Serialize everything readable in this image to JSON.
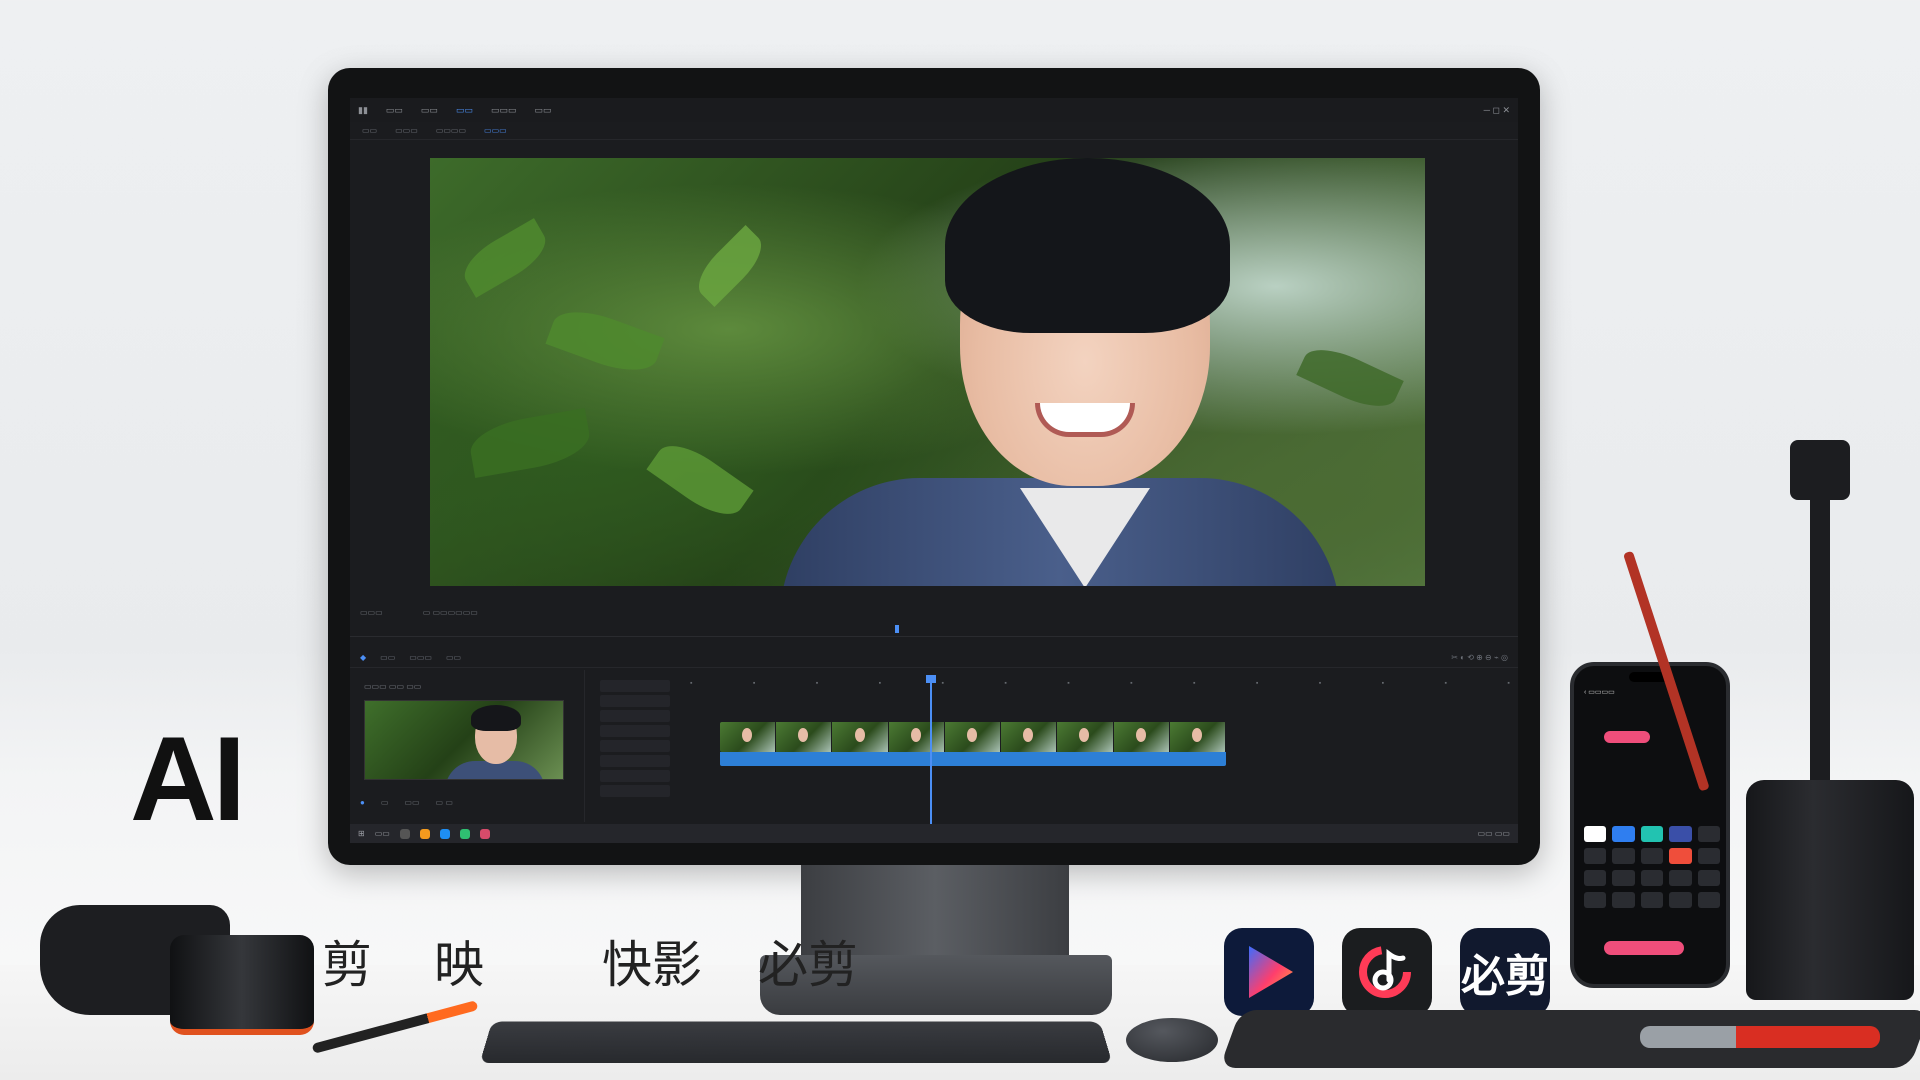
{
  "headline": {
    "title": "AI"
  },
  "apps": [
    {
      "name": "剪映"
    },
    {
      "name": "快影"
    },
    {
      "name": "必剪"
    }
  ],
  "app_icons": {
    "jianying": {
      "icon": "jianying-play-icon",
      "colors": [
        "#3b6cff",
        "#ff3e6c",
        "#ffb13b"
      ]
    },
    "kuaiying": {
      "icon": "kuaiying-note-icon",
      "colors": [
        "#ffffff",
        "#ff3b57"
      ]
    },
    "bijian": {
      "icon": "bijian-text-icon",
      "label": "必剪"
    }
  },
  "accent": "#4c8ff5",
  "timeline_clip_color": "#2d7fd6"
}
